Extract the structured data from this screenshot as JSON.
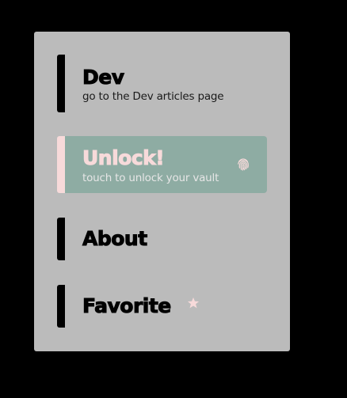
{
  "menu": {
    "items": [
      {
        "title": "Dev",
        "subtitle": "go to the Dev articles page",
        "active": false
      },
      {
        "title": "Unlock!",
        "subtitle": "touch to unlock your vault",
        "active": true,
        "icon": "fingerprint-icon"
      },
      {
        "title": "About",
        "active": false
      },
      {
        "title": "Favorite",
        "active": false,
        "icon": "star-icon"
      }
    ]
  },
  "colors": {
    "background": "#000000",
    "panel": "#bbbbbb",
    "active_item_bg": "#8eaca3",
    "accent_pink": "#f7dada",
    "text_dark": "#000000"
  }
}
